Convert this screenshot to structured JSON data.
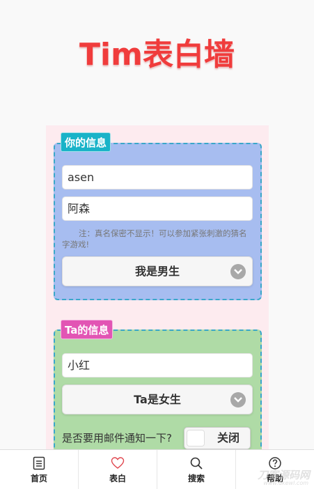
{
  "header": {
    "title": "Tim表白墙"
  },
  "your_info": {
    "legend": "你的信息",
    "name_value": "asen",
    "realname_value": "阿森",
    "note": "注：真名保密不显示！可以参加紧张刺激的猜名字游戏!",
    "gender_selected": "我是男生"
  },
  "ta_info": {
    "legend": "Ta的信息",
    "name_value": "小红",
    "gender_selected": "Ta是女生"
  },
  "notify": {
    "label": "是否要用邮件通知一下?",
    "toggle_text": "关闭"
  },
  "tabbar": {
    "items": [
      {
        "label": "首页",
        "icon": "document-icon"
      },
      {
        "label": "表白",
        "icon": "heart-icon"
      },
      {
        "label": "搜索",
        "icon": "search-icon"
      },
      {
        "label": "帮助",
        "icon": "help-icon"
      }
    ]
  },
  "watermark": {
    "text": "刀客源码网",
    "sub": "www.dkewl.com"
  },
  "colors": {
    "title": "#f03c3c",
    "your_panel": "#a7bdf0",
    "ta_panel": "#afdba6",
    "your_legend": "#19b3c8",
    "ta_legend": "#e255b4",
    "heart": "#e0464e"
  }
}
